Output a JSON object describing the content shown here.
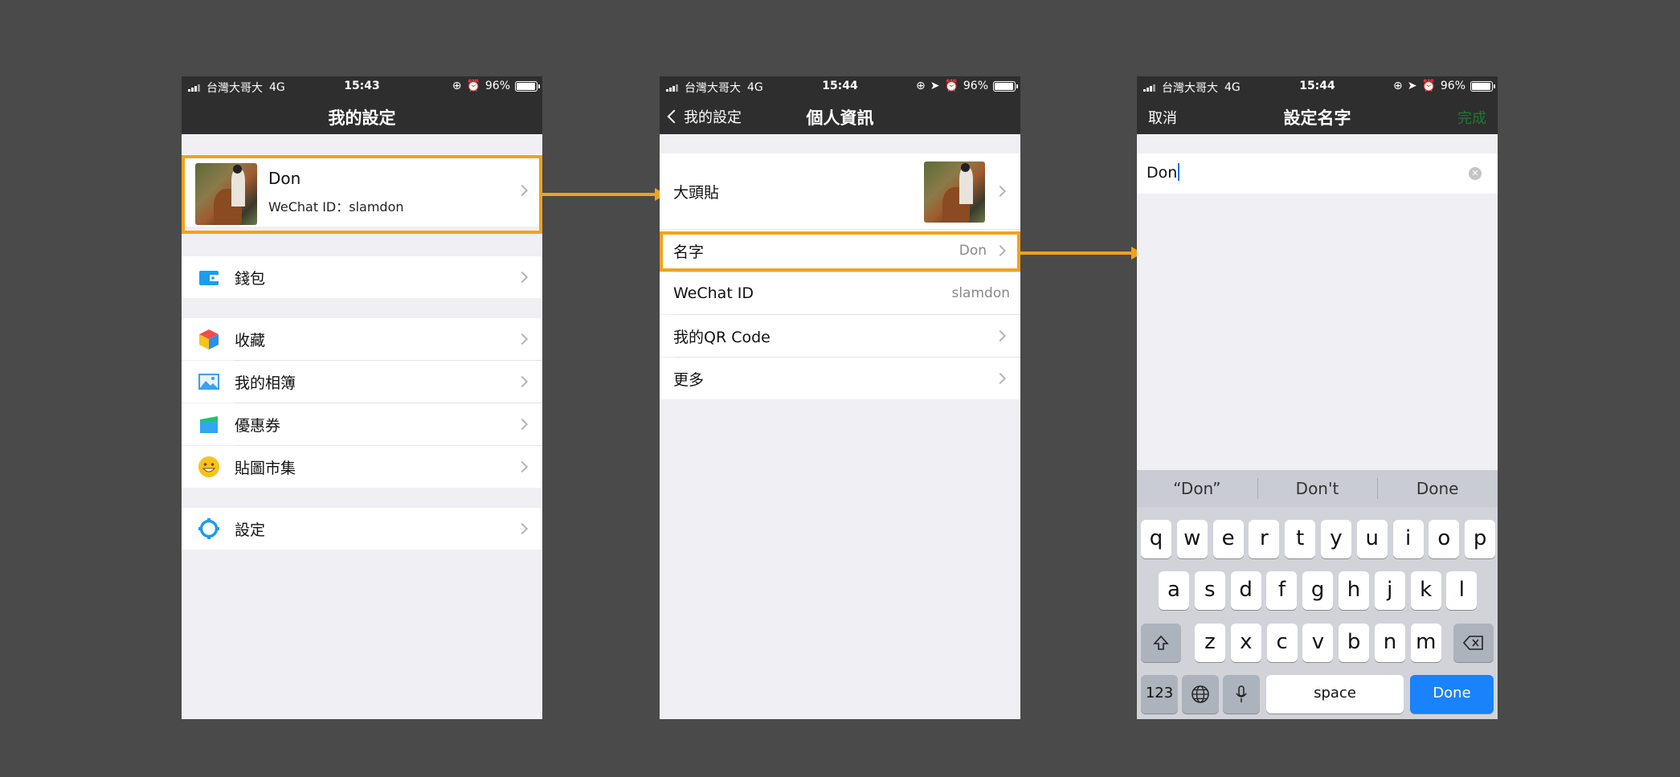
{
  "status": {
    "carrier": "台灣大哥大",
    "network": "4G",
    "battery": "96%",
    "time1": "15:43",
    "time2": "15:44",
    "time3": "15:44"
  },
  "screen1": {
    "title": "我的設定",
    "profile": {
      "name": "Don",
      "wechat_id": "WeChat ID：slamdon"
    },
    "items": [
      {
        "label": "錢包",
        "icon": "wallet-icon"
      },
      {
        "label": "收藏",
        "icon": "favorites-cube-icon"
      },
      {
        "label": "我的相簿",
        "icon": "album-picture-icon"
      },
      {
        "label": "優惠券",
        "icon": "coupon-icon"
      },
      {
        "label": "貼圖市集",
        "icon": "sticker-smiley-icon"
      },
      {
        "label": "設定",
        "icon": "settings-gear-icon"
      }
    ]
  },
  "screen2": {
    "back": "我的設定",
    "title": "個人資訊",
    "items": [
      {
        "label": "大頭貼",
        "value": ""
      },
      {
        "label": "名字",
        "value": "Don"
      },
      {
        "label": "WeChat ID",
        "value": "slamdon"
      },
      {
        "label": "我的QR Code",
        "value": ""
      },
      {
        "label": "更多",
        "value": ""
      }
    ]
  },
  "screen3": {
    "cancel": "取消",
    "title": "設定名字",
    "done": "完成",
    "input_value": "Don",
    "suggestions": [
      "“Don”",
      "Don't",
      "Done"
    ],
    "row1": [
      "q",
      "w",
      "e",
      "r",
      "t",
      "y",
      "u",
      "i",
      "o",
      "p"
    ],
    "row2": [
      "a",
      "s",
      "d",
      "f",
      "g",
      "h",
      "j",
      "k",
      "l"
    ],
    "row3": [
      "z",
      "x",
      "c",
      "v",
      "b",
      "n",
      "m"
    ],
    "key_123": "123",
    "key_space": "space",
    "key_done": "Done"
  },
  "colors": {
    "highlight": "#f2a21c",
    "navbar": "#2e2e2e",
    "done_key": "#1a82fb"
  }
}
